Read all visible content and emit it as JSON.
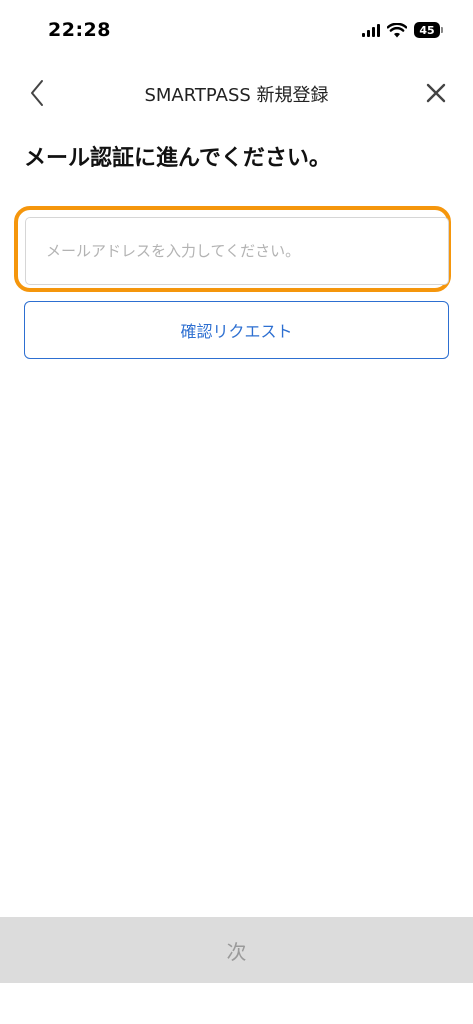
{
  "status_bar": {
    "time": "22:28",
    "battery_level": "45",
    "icons": [
      "signal-icon",
      "wifi-icon",
      "battery-icon"
    ]
  },
  "nav": {
    "title": "SMARTPASS 新規登録",
    "back_icon": "chevron-left-icon",
    "close_icon": "close-icon"
  },
  "main": {
    "heading": "メール認証に進んでください。",
    "email_placeholder": "メールアドレスを入力してください。",
    "email_value": "",
    "request_button_label": "確認リクエスト"
  },
  "footer": {
    "next_button_label": "次"
  },
  "colors": {
    "accent_blue": "#2d6fd1",
    "highlight_orange": "#f5960c",
    "disabled_gray": "#dcdcdc"
  }
}
